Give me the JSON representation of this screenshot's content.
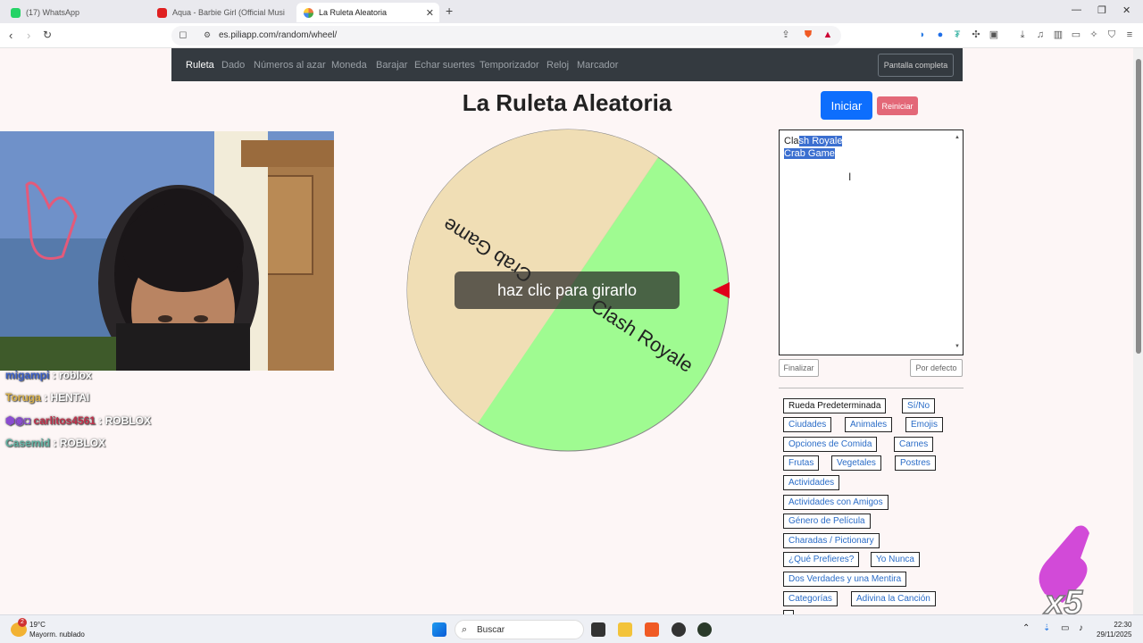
{
  "browser": {
    "tabs": [
      {
        "label": "(17) WhatsApp",
        "icon": "whatsapp-icon"
      },
      {
        "label": "Aqua - Barbie Girl (Official Musi",
        "icon": "youtube-icon"
      },
      {
        "label": "La Ruleta Aleatoria",
        "icon": "site-icon"
      }
    ],
    "url": "es.piliapp.com/random/wheel/"
  },
  "nav": {
    "items": [
      "Ruleta",
      "Dado",
      "Números al azar",
      "Moneda",
      "Barajar",
      "Echar suertes",
      "Temporizador",
      "Reloj",
      "Marcador"
    ],
    "fullscreen": "Pantalla completa"
  },
  "page": {
    "title": "La Ruleta Aleatoria",
    "start": "Iniciar",
    "reset": "Reiniciar",
    "spin_prompt": "haz clic para girarlo"
  },
  "wheel": {
    "segments": [
      {
        "label": "Crab Game",
        "color": "#f0deb5"
      },
      {
        "label": "Clash Royale",
        "color": "#9ffb91"
      }
    ],
    "pointer_color": "#e0001a"
  },
  "editor": {
    "lines_prefix": [
      "Cla",
      ""
    ],
    "lines_selected": [
      "sh Royale",
      "Crab Game"
    ],
    "finish": "Finalizar",
    "default": "Por defecto"
  },
  "presets": [
    "Rueda Predeterminada",
    "Sí/No",
    "Ciudades",
    "Animales",
    "Emojis",
    "Opciones de Comida",
    "Carnes",
    "Frutas",
    "Vegetales",
    "Postres",
    "Actividades",
    "Actividades con Amigos",
    "Género de Película",
    "Charadas / Pictionary",
    "¿Qué Prefieres?",
    "Yo Nunca",
    "Dos Verdades y una Mentira",
    "Categorías",
    "Adivina la Canción"
  ],
  "chat": [
    {
      "user": "migampi",
      "msg": "roblox",
      "color": "#3a5fc8"
    },
    {
      "user": "Toruga",
      "msg": "HENTAI",
      "color": "#d8b04a"
    },
    {
      "user": "carlitos4561",
      "msg": "ROBLOX",
      "color": "#c0304a"
    },
    {
      "user": "Casemid",
      "msg": "ROBLOX",
      "color": "#5fb0a0"
    }
  ],
  "overlay": {
    "multiplier": "x5"
  },
  "taskbar": {
    "weather_temp": "19°C",
    "weather_desc": "Mayorm. nublado",
    "search": "Buscar",
    "time": "22:30",
    "date": "29/11/2025",
    "weather_badge": "2"
  }
}
